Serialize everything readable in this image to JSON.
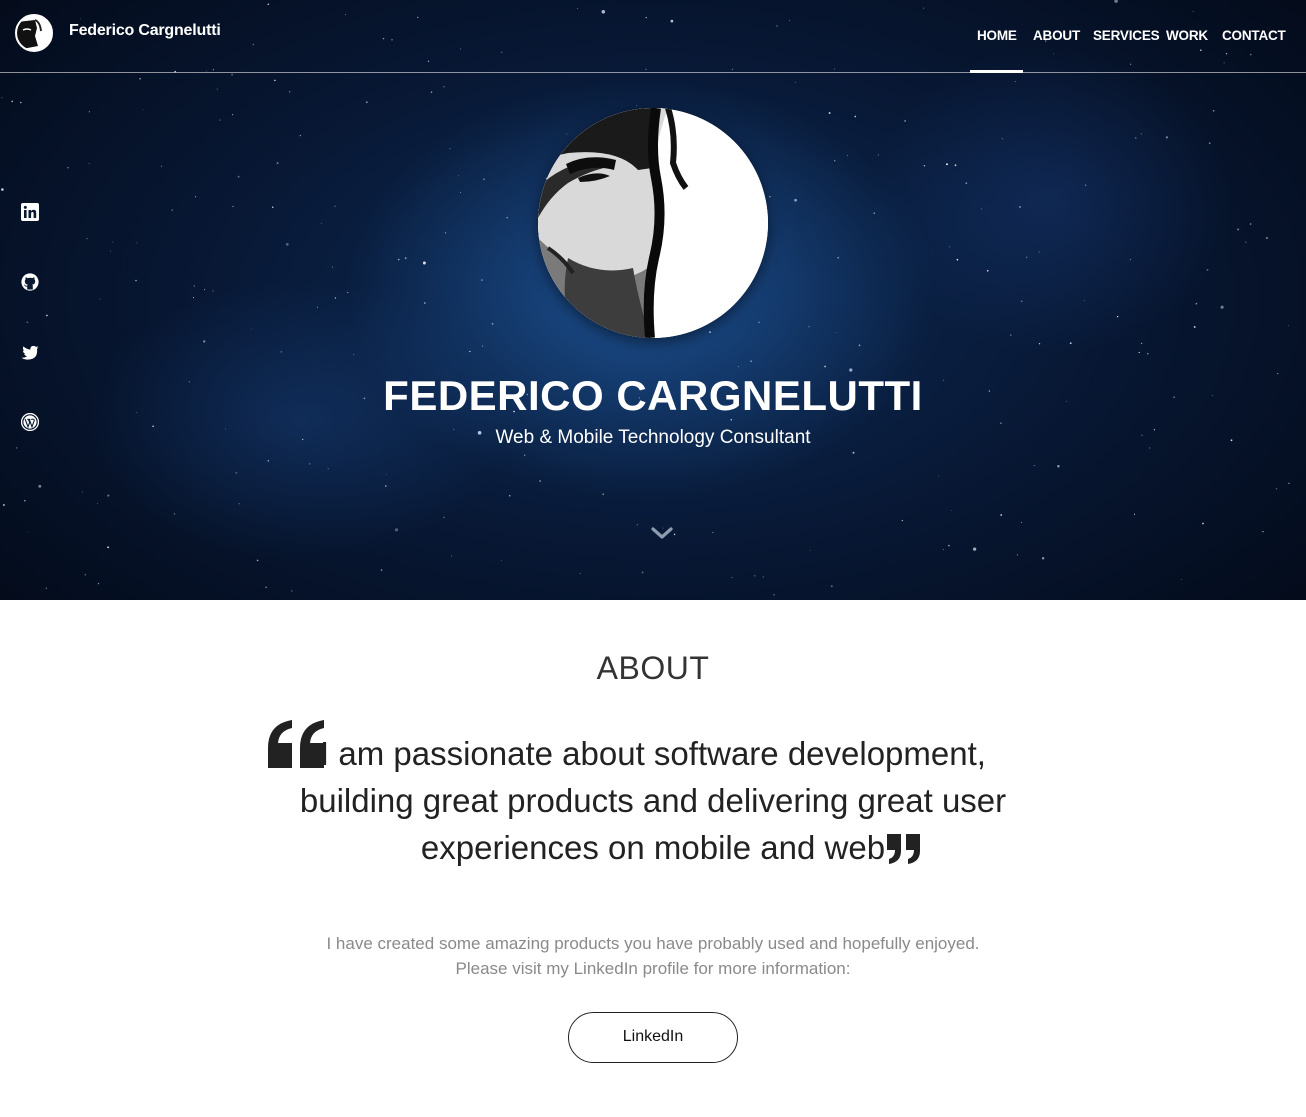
{
  "brand": {
    "name": "Federico Cargnelutti"
  },
  "nav": {
    "items": [
      {
        "label": "HOME"
      },
      {
        "label": "ABOUT"
      },
      {
        "label": "SERVICES"
      },
      {
        "label": "WORK"
      },
      {
        "label": "CONTACT"
      }
    ],
    "active": "HOME"
  },
  "social": {
    "icons": [
      "linkedin-icon",
      "github-icon",
      "twitter-icon",
      "wordpress-icon"
    ]
  },
  "hero": {
    "title": "FEDERICO CARGNELUTTI",
    "subtitle": "Web & Mobile Technology Consultant",
    "scroll_icon": "chevron-down-icon"
  },
  "about": {
    "heading": "ABOUT",
    "quote_lines": [
      "I am passionate about software development,",
      "building great products and delivering great user",
      "experiences on mobile and web"
    ],
    "description_lines": [
      "I have created some amazing products you have probably used and hopefully enjoyed.",
      "Please visit my LinkedIn profile for more information:"
    ],
    "button_label": "LinkedIn"
  },
  "colors": {
    "hero_dark": "#030a18",
    "hero_blue": "#0d2a55",
    "text_dark": "#222222",
    "text_muted": "#8a8a8a"
  }
}
